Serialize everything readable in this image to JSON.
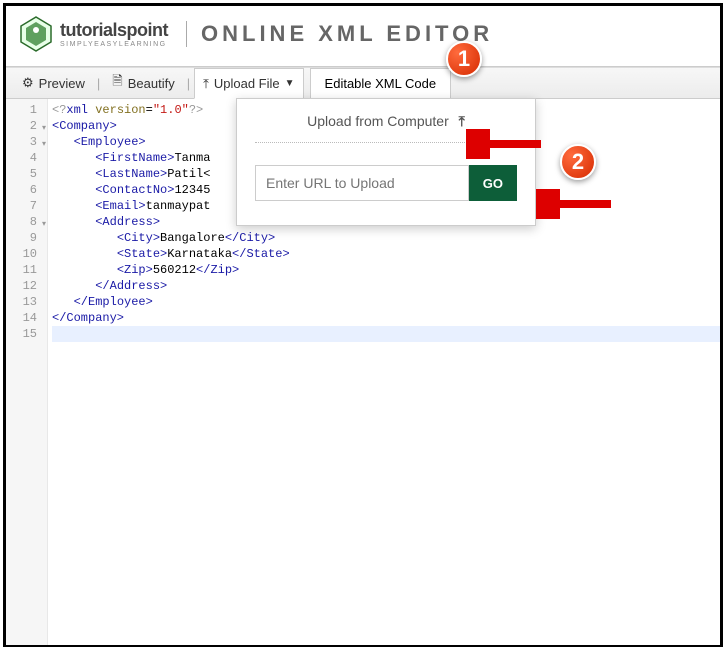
{
  "logo": {
    "main": "tutorialspoint",
    "sub": "SIMPLYEASYLEARNING"
  },
  "title": "ONLINE XML EDITOR",
  "toolbar": {
    "preview": "Preview",
    "beautify": "Beautify",
    "upload": "Upload File",
    "tab": "Editable XML Code"
  },
  "dropdown": {
    "computer": "Upload from Computer",
    "placeholder": "Enter URL to Upload",
    "go": "GO"
  },
  "badges": {
    "one": "1",
    "two": "2"
  },
  "code": {
    "lines": [
      {
        "n": "1",
        "html": "<span class='decl'>&lt;?</span><span class='tag'>xml</span> <span class='attr'>version</span>=<span class='val'>\"1.0\"</span><span class='decl'>?&gt;</span>"
      },
      {
        "n": "2",
        "fold": true,
        "html": "<span class='tag'>&lt;Company&gt;</span>"
      },
      {
        "n": "3",
        "fold": true,
        "html": "   <span class='tag'>&lt;Employee&gt;</span>"
      },
      {
        "n": "4",
        "html": "      <span class='tag'>&lt;FirstName&gt;</span><span class='text'>Tanma</span>"
      },
      {
        "n": "5",
        "html": "      <span class='tag'>&lt;LastName&gt;</span><span class='text'>Patil&lt;</span>"
      },
      {
        "n": "6",
        "html": "      <span class='tag'>&lt;ContactNo&gt;</span><span class='text'>12345</span>"
      },
      {
        "n": "7",
        "html": "      <span class='tag'>&lt;Email&gt;</span><span class='text'>tanmaypat</span>"
      },
      {
        "n": "8",
        "fold": true,
        "html": "      <span class='tag'>&lt;Address&gt;</span>"
      },
      {
        "n": "9",
        "html": "         <span class='tag'>&lt;City&gt;</span><span class='text'>Bangalore</span><span class='tag'>&lt;/City&gt;</span>"
      },
      {
        "n": "10",
        "html": "         <span class='tag'>&lt;State&gt;</span><span class='text'>Karnataka</span><span class='tag'>&lt;/State&gt;</span>"
      },
      {
        "n": "11",
        "html": "         <span class='tag'>&lt;Zip&gt;</span><span class='text'>560212</span><span class='tag'>&lt;/Zip&gt;</span>"
      },
      {
        "n": "12",
        "html": "      <span class='tag'>&lt;/Address&gt;</span>"
      },
      {
        "n": "13",
        "html": "   <span class='tag'>&lt;/Employee&gt;</span>"
      },
      {
        "n": "14",
        "html": "<span class='tag'>&lt;/Company&gt;</span>"
      },
      {
        "n": "15",
        "active": true,
        "html": ""
      }
    ]
  }
}
